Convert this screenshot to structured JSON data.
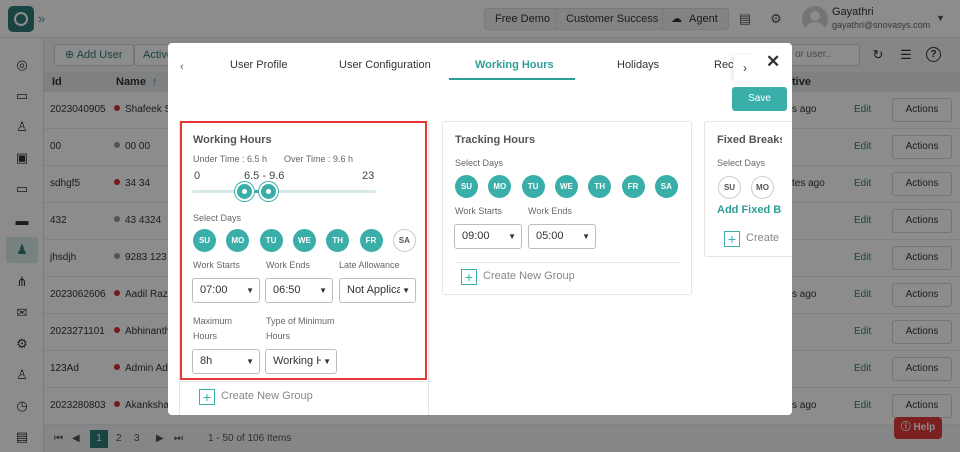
{
  "header": {
    "buttons": [
      "Free Demo",
      "Customer Success",
      "Agent"
    ],
    "user_name": "Gayathri",
    "user_email": "gayathri@snovasys.com"
  },
  "toolbar": {
    "add_user": "Add User",
    "active_label": "Active",
    "search_placeholder": "or user..",
    "help_icon": "?"
  },
  "table": {
    "columns": [
      "Id",
      "Name",
      "tive"
    ],
    "rows": [
      {
        "id": "2023040905",
        "name": "Shafeek S",
        "active": "s ago",
        "edit": "Edit",
        "action": "Actions"
      },
      {
        "id": "00",
        "name": "00 00",
        "active": "",
        "edit": "Edit",
        "action": "Actions"
      },
      {
        "id": "sdhgf5",
        "name": "34 34",
        "active": "tes ago",
        "edit": "Edit",
        "action": "Actions"
      },
      {
        "id": "432",
        "name": "43 4324",
        "active": "",
        "edit": "Edit",
        "action": "Actions"
      },
      {
        "id": "jhsdjh",
        "name": "9283 123",
        "active": "",
        "edit": "Edit",
        "action": "Actions"
      },
      {
        "id": "2023062606",
        "name": "Aadil Raza",
        "active": "s ago",
        "edit": "Edit",
        "action": "Actions"
      },
      {
        "id": "2023271101",
        "name": "Abhinanth",
        "active": "",
        "edit": "Edit",
        "action": "Actions"
      },
      {
        "id": "123Ad",
        "name": "Admin Ad",
        "active": "",
        "edit": "Edit",
        "action": "Actions"
      },
      {
        "id": "2023280803",
        "name": "Akanksha",
        "active": "s ago",
        "edit": "Edit",
        "action": "Actions"
      }
    ]
  },
  "pager": {
    "pages": [
      "1",
      "2",
      "3"
    ],
    "summary": "1 - 50 of 106 Items"
  },
  "help": "Help",
  "modal": {
    "tabs": [
      "User Profile",
      "User Configuration",
      "Working Hours",
      "Holidays",
      "Reco"
    ],
    "active_tab": "Working Hours",
    "save": "Save",
    "working_hours": {
      "title": "Working Hours",
      "under_time": "Under Time : 6.5 h",
      "over_time": "Over Time : 9.6 h",
      "slider_min": "0",
      "slider_max": "23",
      "slider_value": "6.5 - 9.6",
      "range_low": 6.5,
      "range_high": 9.6,
      "select_days": "Select Days",
      "days": [
        "SU",
        "MO",
        "TU",
        "WE",
        "TH",
        "FR",
        "SA"
      ],
      "work_starts_label": "Work Starts",
      "work_ends_label": "Work Ends",
      "late_allowance_label": "Late Allowance",
      "work_starts": "07:00",
      "work_ends": "06:50",
      "late_allowance": "Not Applicab",
      "max_hours_label_1": "Maximum",
      "max_hours_label_2": "Hours",
      "min_type_label_1": "Type of Minimum",
      "min_type_label_2": "Hours",
      "max_hours": "8h",
      "min_type": "Working H",
      "create_group": "Create New Group"
    },
    "tracking_hours": {
      "title": "Tracking Hours",
      "select_days": "Select Days",
      "days": [
        "SU",
        "MO",
        "TU",
        "WE",
        "TH",
        "FR",
        "SA"
      ],
      "work_starts_label": "Work Starts",
      "work_ends_label": "Work Ends",
      "work_starts": "09:00",
      "work_ends": "05:00",
      "create_group": "Create New Group"
    },
    "fixed_breaks": {
      "title": "Fixed Breaks",
      "select_days": "Select Days",
      "days": [
        "SU",
        "MO"
      ],
      "add_fixed": "Add Fixed Br",
      "create": "Create"
    }
  }
}
